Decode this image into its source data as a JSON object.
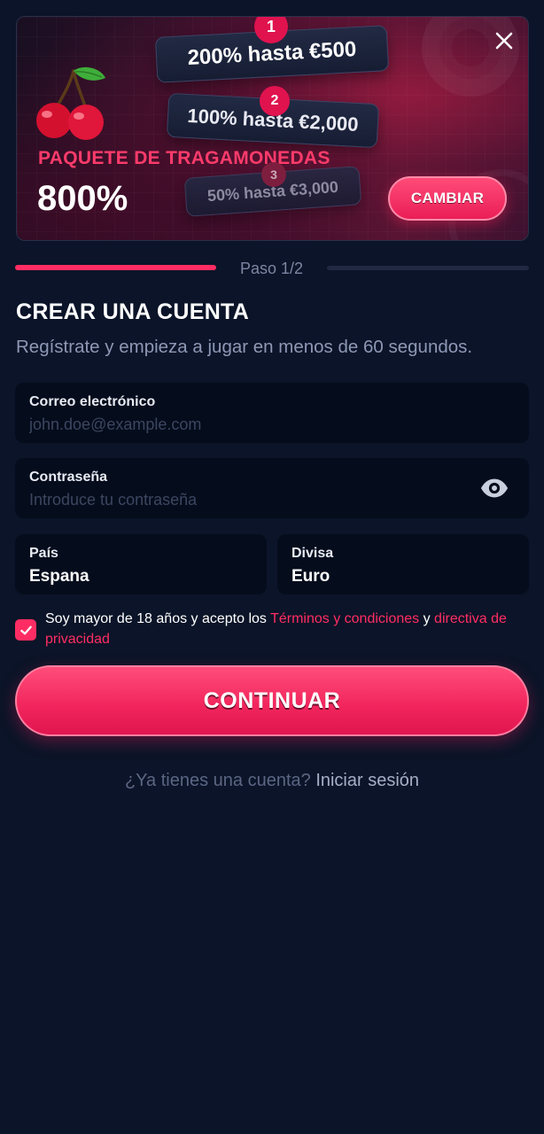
{
  "promo": {
    "tiers": [
      {
        "number": "1",
        "text": "200% hasta €500"
      },
      {
        "number": "2",
        "text": "100% hasta €2,000"
      },
      {
        "number": "3",
        "text": "50% hasta €3,000"
      }
    ],
    "title": "PAQUETE DE TRAGAMONEDAS",
    "percent": "800%",
    "change_label": "CAMBIAR",
    "close_icon": "close-icon",
    "image_icon": "cherry-icon"
  },
  "steps": {
    "label": "Paso 1/2",
    "current": 1,
    "total": 2
  },
  "form": {
    "title": "CREAR UNA CUENTA",
    "subtitle": "Regístrate y empieza a jugar en menos de 60 segundos.",
    "email": {
      "label": "Correo electrónico",
      "placeholder": "john.doe@example.com",
      "value": ""
    },
    "password": {
      "label": "Contraseña",
      "placeholder": "Introduce tu contraseña",
      "value": "",
      "toggle_icon": "eye-icon"
    },
    "country": {
      "label": "País",
      "value": "Espana"
    },
    "currency": {
      "label": "Divisa",
      "value": "Euro"
    },
    "terms": {
      "checked": true,
      "text_before": "Soy mayor de 18 años y acepto los ",
      "terms_link": "Términos y condiciones",
      "text_and": " y ",
      "privacy_link": "directiva de privacidad"
    },
    "continue_label": "CONTINUAR",
    "login_prompt": "¿Ya tienes una cuenta?",
    "login_link": "Iniciar sesión"
  },
  "colors": {
    "background": "#0b1428",
    "accent": "#ff2d63",
    "field_bg": "#050c1c",
    "muted_text": "#8e98b5"
  }
}
